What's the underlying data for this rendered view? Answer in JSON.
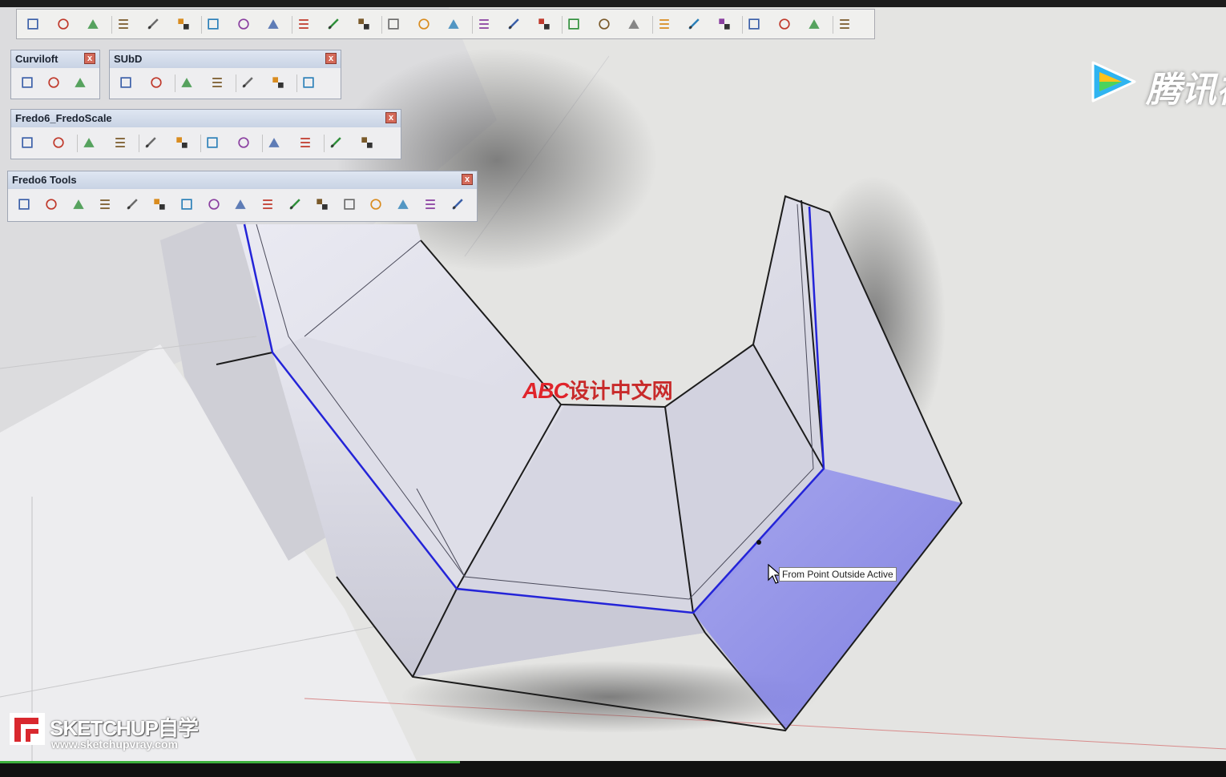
{
  "main_toolbar": {
    "icons": [
      "select-icon",
      "rect-view-icon",
      "rect-view2-icon",
      "align-list-icon",
      "add-list-icon",
      "remove-list-icon",
      "line-icon",
      "plus-line-icon",
      "minus-line-icon",
      "diagonal-icon",
      "grid-quad-icon",
      "grid-quad-red-icon",
      "table-icon",
      "table2-icon",
      "grid-cross-icon",
      "push-icon",
      "paint-icon",
      "camera-icon",
      "checker-icon",
      "copy-icon",
      "rotate-icon",
      "move-icon",
      "panel-icon",
      "panel2-icon",
      "arrow-left-icon",
      "arrow-right-icon",
      "panel3-icon",
      "pencil-icon"
    ]
  },
  "curviloft": {
    "title": "Curviloft",
    "close": "x",
    "icons": [
      "loft-icon",
      "skin-icon",
      "spline-icon"
    ]
  },
  "subd": {
    "title": "SUbD",
    "close": "x",
    "icons": [
      "sphere-icon",
      "subdivide-icon",
      "smooth-icon",
      "crease-icon",
      "knife-icon",
      "cube-icon",
      "bevel-icon"
    ]
  },
  "fredoscale": {
    "title": "Fredo6_FredoScale",
    "close": "x",
    "icons": [
      "scale-icon",
      "box-scale-icon",
      "stretch-icon",
      "tapering-icon",
      "planar-shear-icon",
      "twist-icon",
      "bend-icon",
      "radial-bend-icon",
      "rotate-ccw-icon",
      "rotate-cw-icon",
      "stretch-red-icon",
      "unbend-icon"
    ]
  },
  "fredotools": {
    "title": "Fredo6 Tools",
    "close": "x",
    "icons": [
      "edge-icon",
      "box-icon",
      "reverse-faces-icon",
      "construct-icon",
      "reverse-arrows-icon",
      "pen-icon",
      "mark-vertices-icon",
      "thru-paint-icon",
      "round-corner-icon",
      "line-tool-icon",
      "count-icon",
      "curvilinear-icon",
      "tag-icon",
      "curve-icon",
      "cylinder-icon",
      "spline-tool-icon",
      "drape-icon"
    ]
  },
  "tooltip": {
    "text": "From Point Outside Active"
  },
  "watermarks": {
    "left_brand": "SKETCHUP自学",
    "left_url": "www.sketchupvray.com",
    "center_latin": "ABC",
    "center_cn": "设计中文网",
    "tencent_text": "腾讯视"
  },
  "colors": {
    "selected_face": "#8a8ae8",
    "edge_blue": "#2424d8",
    "toolbar_bg": "#f0f0ee",
    "panel_title": "#cfd8e6"
  },
  "video_progress": 0.375
}
